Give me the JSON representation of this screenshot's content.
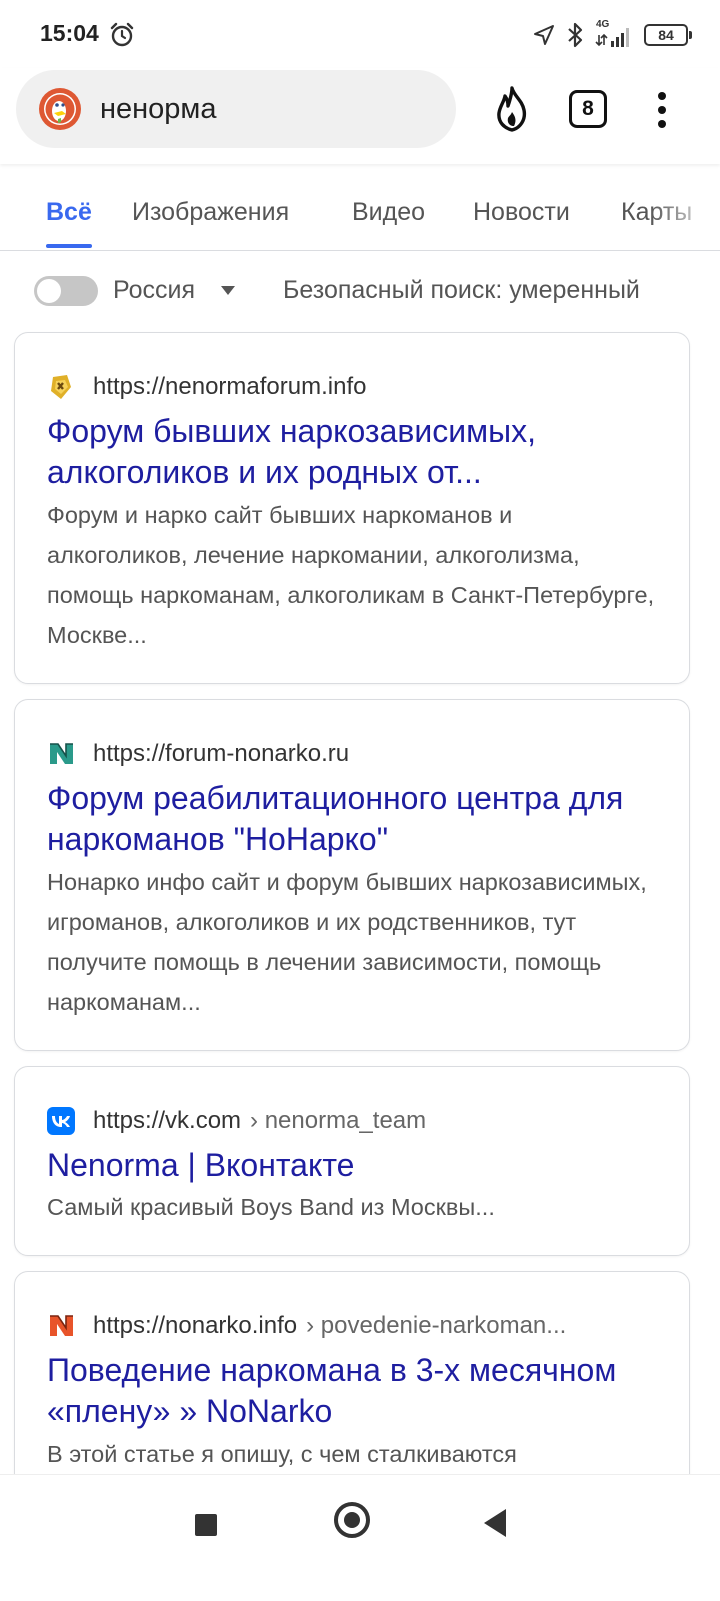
{
  "status_bar": {
    "time": "15:04",
    "network": "4G",
    "battery": "84"
  },
  "browser": {
    "search_query": "ненорма",
    "tab_count": "8"
  },
  "category_tabs": [
    "Всё",
    "Изображения",
    "Видео",
    "Новости",
    "Карты"
  ],
  "filters": {
    "region": "Россия",
    "safe_search": "Безопасный поиск: умеренный"
  },
  "results": [
    {
      "url": "https://nenormaforum.info",
      "path": "",
      "title": "Форум бывших наркозависимых, алкоголиков и их родных от...",
      "snippet": "Форум и нарко сайт бывших наркоманов и алкоголиков, лечение наркомании, алкоголизма, помощь наркоманам, алкоголикам в Санкт-Петербурге, Москве...",
      "favicon_color": "#e0b028"
    },
    {
      "url": "https://forum-nonarko.ru",
      "path": "",
      "title": "Форум реабилитационного центра для наркоманов \"НоНарко\"",
      "snippet": "Нонарко инфо сайт и форум бывших наркозависимых, игроманов, алкоголиков и их родственников, тут получите помощь в лечении зависимости, помощь наркоманам...",
      "favicon_color": "#2a9a8a"
    },
    {
      "url": "https://vk.com",
      "path": "› nenorma_team",
      "title": "Nenorma | Вконтакте",
      "snippet": "Самый красивый Boys Band из Москвы...",
      "favicon_color": "#0077ff"
    },
    {
      "url": "https://nonarko.info",
      "path": "› povedenie-narkoman...",
      "title": "Поведение наркомана в 3-х месячном «плену» » NoNarko",
      "snippet": "В этой статье я опишу, с чем сталкиваются",
      "favicon_color": "#e8542a"
    }
  ],
  "colors": {
    "accent": "#3969ef",
    "link": "#1e1ea0"
  }
}
